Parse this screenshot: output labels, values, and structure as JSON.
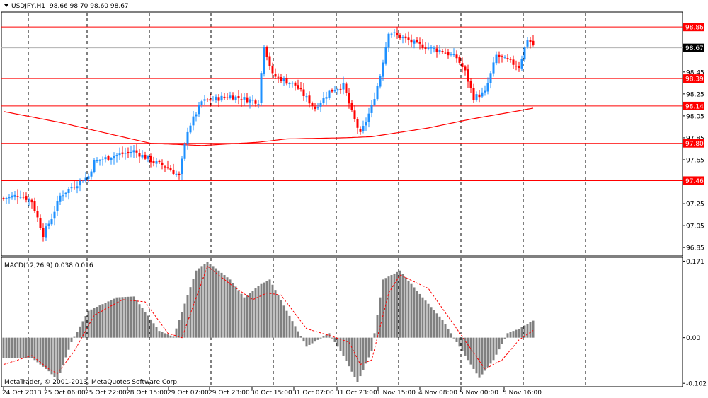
{
  "header": {
    "symbol_label": "USDJPY,H1",
    "ohlc_label": "98.66 98.70 98.60 98.67",
    "macd_label": "MACD(12,26,9) 0.038 0.016",
    "copyright": "MetaTrader, © 2001-2013, MetaQuotes Software Corp."
  },
  "colors": {
    "bull": "#1e90ff",
    "bear": "#ff0000",
    "ma": "#ff0000",
    "hline": "#ff0000",
    "histogram": "#808080",
    "signal": "#ff0000"
  },
  "chart_data": [
    {
      "type": "candlestick",
      "title": "USDJPY,H1",
      "ylim": [
        96.78,
        98.99
      ],
      "y_ticks": [
        "98.86",
        "98.67",
        "98.45",
        "98.39",
        "98.25",
        "98.14",
        "98.05",
        "97.85",
        "97.80",
        "97.65",
        "97.46",
        "97.25",
        "97.05",
        "96.85"
      ],
      "current_price": 98.67,
      "horizontal_levels": [
        98.86,
        98.39,
        98.14,
        97.8,
        97.46
      ],
      "x_tick_labels": [
        "24 Oct 2013",
        "25 Oct 06:00",
        "25 Oct 22:00",
        "28 Oct 15:00",
        "29 Oct 07:00",
        "29 Oct 23:00",
        "30 Oct 15:00",
        "31 Oct 07:00",
        "31 Oct 23:00",
        "1 Nov 15:00",
        "4 Nov 08:00",
        "5 Nov 00:00",
        "5 Nov 16:00"
      ],
      "close_anchors": [
        [
          0,
          97.3
        ],
        [
          6,
          97.33
        ],
        [
          10,
          97.27
        ],
        [
          14,
          96.97
        ],
        [
          17,
          97.12
        ],
        [
          20,
          97.32
        ],
        [
          24,
          97.4
        ],
        [
          30,
          97.5
        ],
        [
          32,
          97.63
        ],
        [
          38,
          97.68
        ],
        [
          46,
          97.73
        ],
        [
          53,
          97.63
        ],
        [
          58,
          97.58
        ],
        [
          62,
          97.5
        ],
        [
          65,
          97.92
        ],
        [
          70,
          98.18
        ],
        [
          80,
          98.23
        ],
        [
          90,
          98.18
        ],
        [
          92,
          98.7
        ],
        [
          95,
          98.42
        ],
        [
          103,
          98.33
        ],
        [
          110,
          98.12
        ],
        [
          115,
          98.27
        ],
        [
          120,
          98.33
        ],
        [
          123,
          98.08
        ],
        [
          126,
          97.88
        ],
        [
          130,
          98.13
        ],
        [
          133,
          98.42
        ],
        [
          136,
          98.82
        ],
        [
          140,
          98.77
        ],
        [
          146,
          98.7
        ],
        [
          155,
          98.64
        ],
        [
          160,
          98.58
        ],
        [
          163,
          98.45
        ],
        [
          166,
          98.22
        ],
        [
          170,
          98.26
        ],
        [
          174,
          98.6
        ],
        [
          178,
          98.55
        ],
        [
          182,
          98.5
        ],
        [
          185,
          98.75
        ],
        [
          187,
          98.7
        ]
      ],
      "ma_anchors": [
        [
          0,
          98.09
        ],
        [
          20,
          97.99
        ],
        [
          40,
          97.87
        ],
        [
          52,
          97.8
        ],
        [
          70,
          97.78
        ],
        [
          90,
          97.81
        ],
        [
          100,
          97.84
        ],
        [
          120,
          97.85
        ],
        [
          130,
          97.86
        ],
        [
          150,
          97.94
        ],
        [
          165,
          98.02
        ],
        [
          187,
          98.12
        ]
      ]
    },
    {
      "type": "bar",
      "title": "MACD(12,26,9) 0.038 0.016",
      "ylim": [
        -0.108,
        0.178
      ],
      "y_ticks": [
        "0.171",
        "0.00",
        "-0.102"
      ],
      "histogram_anchors": [
        [
          0,
          -0.045
        ],
        [
          10,
          -0.045
        ],
        [
          16,
          -0.075
        ],
        [
          19,
          -0.095
        ],
        [
          24,
          -0.01
        ],
        [
          30,
          0.06
        ],
        [
          40,
          0.09
        ],
        [
          46,
          0.092
        ],
        [
          55,
          0.015
        ],
        [
          60,
          0.002
        ],
        [
          68,
          0.15
        ],
        [
          72,
          0.17
        ],
        [
          80,
          0.13
        ],
        [
          85,
          0.09
        ],
        [
          91,
          0.12
        ],
        [
          94,
          0.13
        ],
        [
          100,
          0.06
        ],
        [
          107,
          -0.02
        ],
        [
          115,
          0.01
        ],
        [
          120,
          -0.04
        ],
        [
          125,
          -0.1
        ],
        [
          130,
          -0.03
        ],
        [
          134,
          0.13
        ],
        [
          140,
          0.15
        ],
        [
          148,
          0.09
        ],
        [
          155,
          0.04
        ],
        [
          160,
          -0.01
        ],
        [
          168,
          -0.09
        ],
        [
          173,
          -0.05
        ],
        [
          178,
          0.01
        ],
        [
          182,
          0.02
        ],
        [
          187,
          0.038
        ]
      ],
      "signal_anchors": [
        [
          0,
          -0.06
        ],
        [
          10,
          -0.04
        ],
        [
          16,
          -0.07
        ],
        [
          19,
          -0.08
        ],
        [
          25,
          -0.03
        ],
        [
          32,
          0.05
        ],
        [
          42,
          0.085
        ],
        [
          50,
          0.08
        ],
        [
          58,
          0.01
        ],
        [
          63,
          0.0
        ],
        [
          72,
          0.16
        ],
        [
          80,
          0.12
        ],
        [
          88,
          0.085
        ],
        [
          93,
          0.1
        ],
        [
          98,
          0.095
        ],
        [
          107,
          0.02
        ],
        [
          115,
          0.005
        ],
        [
          122,
          -0.01
        ],
        [
          126,
          -0.06
        ],
        [
          130,
          -0.05
        ],
        [
          136,
          0.1
        ],
        [
          140,
          0.14
        ],
        [
          150,
          0.11
        ],
        [
          160,
          0.02
        ],
        [
          170,
          -0.07
        ],
        [
          176,
          -0.05
        ],
        [
          182,
          -0.005
        ],
        [
          187,
          0.016
        ]
      ]
    }
  ]
}
